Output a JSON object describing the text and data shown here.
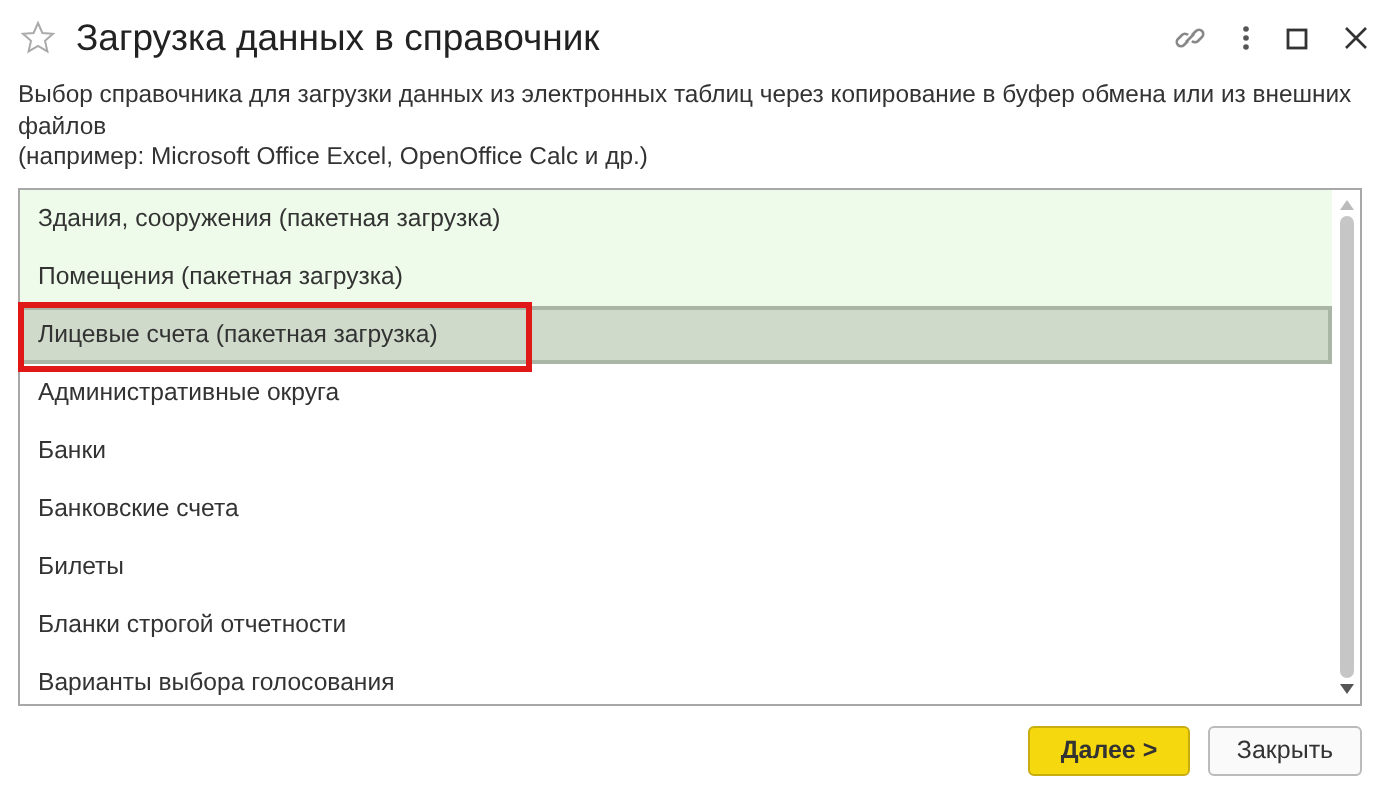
{
  "window": {
    "title": "Загрузка данных в справочник",
    "favorite": false
  },
  "description": [
    "Выбор справочника для загрузки данных из электронных таблиц через копирование в буфер обмена или из внешних файлов",
    "(например: Microsoft Office Excel, OpenOffice Calc и др.)"
  ],
  "list": {
    "items": [
      {
        "label": "Здания, сооружения (пакетная загрузка)",
        "kind": "batch",
        "selected": false,
        "highlighted": false
      },
      {
        "label": "Помещения (пакетная загрузка)",
        "kind": "batch",
        "selected": false,
        "highlighted": false
      },
      {
        "label": "Лицевые счета (пакетная загрузка)",
        "kind": "batch",
        "selected": true,
        "highlighted": true
      },
      {
        "label": "Административные округа",
        "kind": "plain",
        "selected": false,
        "highlighted": false
      },
      {
        "label": "Банки",
        "kind": "plain",
        "selected": false,
        "highlighted": false
      },
      {
        "label": "Банковские счета",
        "kind": "plain",
        "selected": false,
        "highlighted": false
      },
      {
        "label": "Билеты",
        "kind": "plain",
        "selected": false,
        "highlighted": false
      },
      {
        "label": "Бланки строгой отчетности",
        "kind": "plain",
        "selected": false,
        "highlighted": false
      },
      {
        "label": "Варианты выбора голосования",
        "kind": "plain",
        "selected": false,
        "highlighted": false
      }
    ]
  },
  "buttons": [
    {
      "label": "Далее >",
      "kind": "primary"
    },
    {
      "label": "Закрыть",
      "kind": "secondary"
    }
  ]
}
